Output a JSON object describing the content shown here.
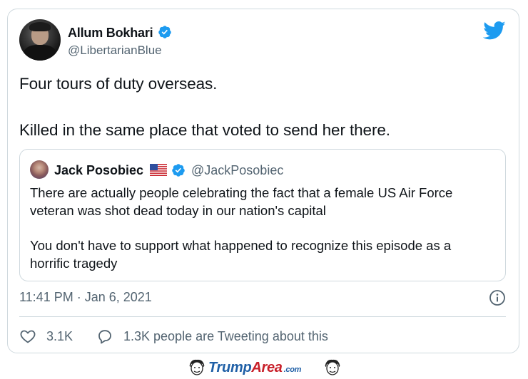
{
  "tweet": {
    "author_name": "Allum Bokhari",
    "author_handle": "@LibertarianBlue",
    "text_lines": [
      "Four tours of duty overseas.",
      "Killed in the same place that voted to send her there."
    ],
    "timestamp": "11:41 PM · Jan 6, 2021",
    "likes": "3.1K",
    "conversation": "1.3K people are Tweeting about this"
  },
  "quoted": {
    "author_name": "Jack Posobiec",
    "author_handle": "@JackPosobiec",
    "text_lines": [
      "There are actually people celebrating the fact that a female US Air Force",
      "veteran was shot dead today in our nation's capital",
      "You don't have to support what happened to recognize this episode as a",
      "horrific tragedy"
    ]
  },
  "footer": {
    "logo_part1": "Trump",
    "logo_part2": "Area",
    "logo_suffix": ".com"
  },
  "colors": {
    "twitter_blue": "#1d9bf0",
    "secondary_text": "#536471",
    "border": "#cfd9de"
  },
  "icons": [
    "verified-badge-icon",
    "twitter-bird-icon",
    "us-flag-icon",
    "info-icon",
    "heart-icon",
    "speech-bubble-icon"
  ]
}
